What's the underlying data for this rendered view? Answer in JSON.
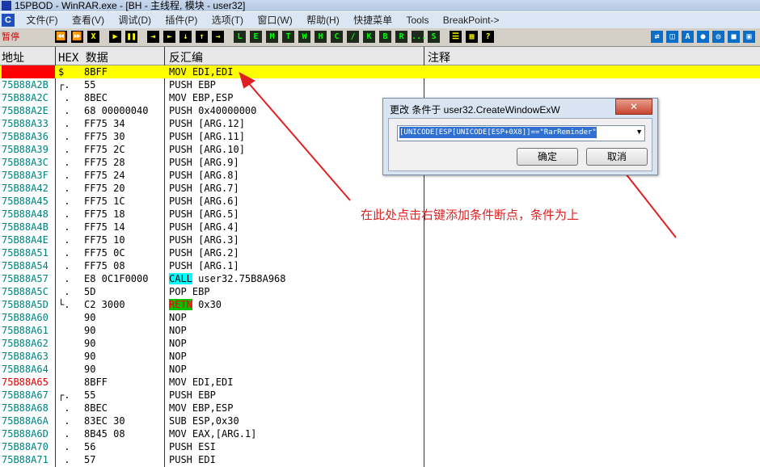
{
  "titlebar": {
    "text": "15PBOD  - WinRAR.exe - [BH - 主线程, 模块 - user32]"
  },
  "menubar": {
    "icon": "C",
    "items": [
      "文件(F)",
      "查看(V)",
      "调试(D)",
      "插件(P)",
      "选项(T)",
      "窗口(W)",
      "帮助(H)",
      "快捷菜单",
      "Tools",
      "BreakPoint->"
    ]
  },
  "toolbar": {
    "status": "暂停",
    "buttons": [
      "⏪",
      "⏩",
      "X",
      "▶",
      "❚❚",
      "⇥",
      "⇤",
      "↓",
      "↑",
      "→",
      "L",
      "E",
      "M",
      "T",
      "W",
      "H",
      "C",
      "/",
      "K",
      "B",
      "R",
      "...",
      "S",
      "☰",
      "▦",
      "?"
    ],
    "right_buttons": [
      "⇄",
      "◫",
      "A",
      "●",
      "◎",
      "■",
      "▣"
    ]
  },
  "header": {
    "addr": "地址",
    "hex": "HEX 数据",
    "dis": "反汇编",
    "comment": "注释"
  },
  "rows": [
    {
      "addr": "",
      "mark": "$",
      "hex": "8BFF",
      "dis": "MOV EDI,EDI",
      "sel": true
    },
    {
      "addr": "75B88A2B",
      "mark": "┌.",
      "hex": "55",
      "dis": "PUSH EBP"
    },
    {
      "addr": "75B88A2C",
      "mark": " .",
      "hex": "8BEC",
      "dis": "MOV EBP,ESP"
    },
    {
      "addr": "75B88A2E",
      "mark": " .",
      "hex": "68 00000040",
      "dis": "PUSH 0x40000000"
    },
    {
      "addr": "75B88A33",
      "mark": " .",
      "hex": "FF75 34",
      "dis": "PUSH [ARG.12]"
    },
    {
      "addr": "75B88A36",
      "mark": " .",
      "hex": "FF75 30",
      "dis": "PUSH [ARG.11]"
    },
    {
      "addr": "75B88A39",
      "mark": " .",
      "hex": "FF75 2C",
      "dis": "PUSH [ARG.10]"
    },
    {
      "addr": "75B88A3C",
      "mark": " .",
      "hex": "FF75 28",
      "dis": "PUSH [ARG.9]"
    },
    {
      "addr": "75B88A3F",
      "mark": " .",
      "hex": "FF75 24",
      "dis": "PUSH [ARG.8]"
    },
    {
      "addr": "75B88A42",
      "mark": " .",
      "hex": "FF75 20",
      "dis": "PUSH [ARG.7]"
    },
    {
      "addr": "75B88A45",
      "mark": " .",
      "hex": "FF75 1C",
      "dis": "PUSH [ARG.6]"
    },
    {
      "addr": "75B88A48",
      "mark": " .",
      "hex": "FF75 18",
      "dis": "PUSH [ARG.5]"
    },
    {
      "addr": "75B88A4B",
      "mark": " .",
      "hex": "FF75 14",
      "dis": "PUSH [ARG.4]"
    },
    {
      "addr": "75B88A4E",
      "mark": " .",
      "hex": "FF75 10",
      "dis": "PUSH [ARG.3]"
    },
    {
      "addr": "75B88A51",
      "mark": " .",
      "hex": "FF75 0C",
      "dis": "PUSH [ARG.2]"
    },
    {
      "addr": "75B88A54",
      "mark": " .",
      "hex": "FF75 08",
      "dis": "PUSH [ARG.1]"
    },
    {
      "addr": "75B88A57",
      "mark": " .",
      "hex": "E8 0C1F0000",
      "kw": "CALL",
      "dis": " user32.75B8A968"
    },
    {
      "addr": "75B88A5C",
      "mark": " .",
      "hex": "5D",
      "dis": "POP EBP"
    },
    {
      "addr": "75B88A5D",
      "mark": "└.",
      "hex": "C2 3000",
      "kw": "RETN",
      "dis": " 0x30"
    },
    {
      "addr": "75B88A60",
      "mark": "",
      "hex": "90",
      "dis": "NOP"
    },
    {
      "addr": "75B88A61",
      "mark": "",
      "hex": "90",
      "dis": "NOP"
    },
    {
      "addr": "75B88A62",
      "mark": "",
      "hex": "90",
      "dis": "NOP"
    },
    {
      "addr": "75B88A63",
      "mark": "",
      "hex": "90",
      "dis": "NOP"
    },
    {
      "addr": "75B88A64",
      "mark": "",
      "hex": "90",
      "dis": "NOP"
    },
    {
      "addr": "75B88A65",
      "mark": "",
      "hex": "8BFF",
      "dis": "MOV EDI,EDI",
      "red": true
    },
    {
      "addr": "75B88A67",
      "mark": "┌.",
      "hex": "55",
      "dis": "PUSH EBP"
    },
    {
      "addr": "75B88A68",
      "mark": " .",
      "hex": "8BEC",
      "dis": "MOV EBP,ESP"
    },
    {
      "addr": "75B88A6A",
      "mark": " .",
      "hex": "83EC 30",
      "dis": "SUB ESP,0x30"
    },
    {
      "addr": "75B88A6D",
      "mark": " .",
      "hex": "8B45 08",
      "dis": "MOV EAX,[ARG.1]"
    },
    {
      "addr": "75B88A70",
      "mark": " .",
      "hex": "56",
      "dis": "PUSH ESI"
    },
    {
      "addr": "75B88A71",
      "mark": " .",
      "hex": "57",
      "dis": "PUSH EDI"
    }
  ],
  "dialog": {
    "title": "更改 条件于 user32.CreateWindowExW",
    "close": "✕",
    "condition": "[UNICODE[ESP[UNICODE[ESP+0X8]]==\"RarReminder\"",
    "ok": "确定",
    "cancel": "取消"
  },
  "annotation": "在此处点击右键添加条件断点，条件为上",
  "colors": {
    "selected_row": "#ffff00",
    "address": "#008080",
    "call_bg": "#00ffff",
    "retn_bg": "#00c000",
    "annotation": "#e02020"
  }
}
